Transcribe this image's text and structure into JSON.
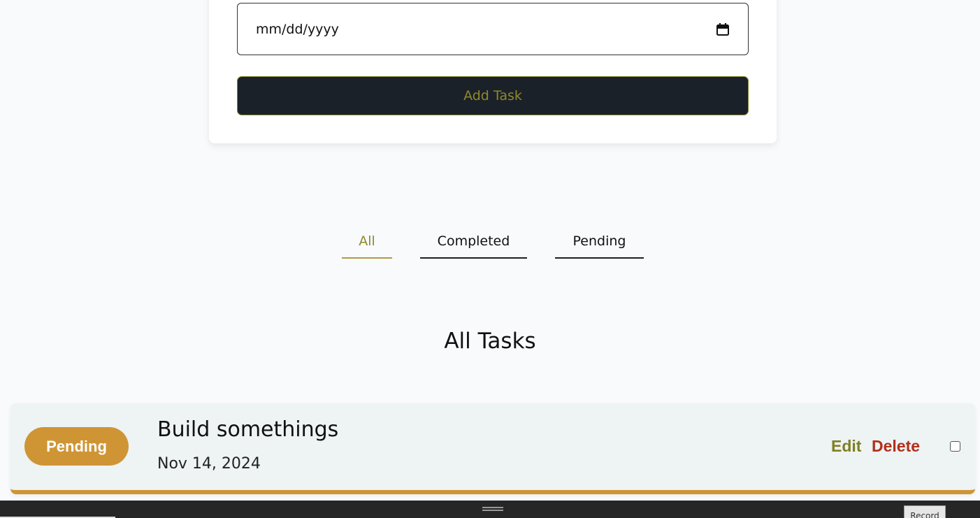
{
  "form": {
    "date_placeholder": "mm/dd/yyyy",
    "calendar_icon": "calendar-icon",
    "add_button_label": "Add Task"
  },
  "tabs": [
    {
      "label": "All",
      "active": true
    },
    {
      "label": "Completed",
      "active": false
    },
    {
      "label": "Pending",
      "active": false
    }
  ],
  "section_title": "All Tasks",
  "tasks": [
    {
      "status": "Pending",
      "title": "Build somethings",
      "date": "Nov 14, 2024",
      "edit_label": "Edit",
      "delete_label": "Delete",
      "checked": false
    }
  ],
  "bottom_bar": {
    "record_label": "Record"
  },
  "colors": {
    "accent": "#cf9535",
    "button_bg": "#1b2128",
    "button_text": "#8f8a2c",
    "edit": "#7f7f22",
    "delete": "#b0301d"
  }
}
